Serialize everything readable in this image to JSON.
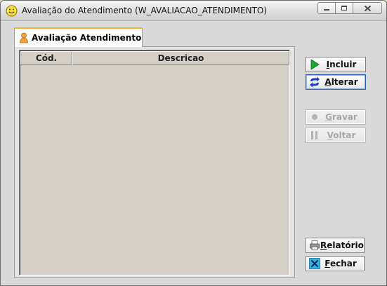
{
  "window": {
    "title": "Avaliação do Atendimento (W_AVALIACAO_ATENDIMENTO)",
    "controls": [
      "minimize",
      "maximize",
      "close"
    ]
  },
  "tab": {
    "label": "Avaliação Atendimento",
    "icon": "person-icon"
  },
  "grid": {
    "columns": [
      "Cód.",
      "Descricao"
    ],
    "rows": []
  },
  "buttons": {
    "incluir": {
      "first": "I",
      "rest": "ncluir",
      "icon": "play-icon",
      "enabled": true
    },
    "alterar": {
      "first": "A",
      "rest": "lterar",
      "icon": "refresh-icon",
      "enabled": true
    },
    "gravar": {
      "first": "G",
      "rest": "ravar",
      "icon": "record-icon",
      "enabled": false
    },
    "voltar": {
      "first": "V",
      "rest": "oltar",
      "icon": "pause-icon",
      "enabled": false
    },
    "relatorio": {
      "first": "R",
      "rest": "elatório",
      "icon": "printer-icon",
      "enabled": true
    },
    "fechar": {
      "first": "F",
      "rest": "echar",
      "icon": "close-x-icon",
      "enabled": true
    }
  },
  "colors": {
    "tab_accent": "#f3b13c",
    "play_green": "#1fa82e",
    "refresh_blue": "#1c3fc8",
    "close_cyan": "#2fb3e0"
  }
}
